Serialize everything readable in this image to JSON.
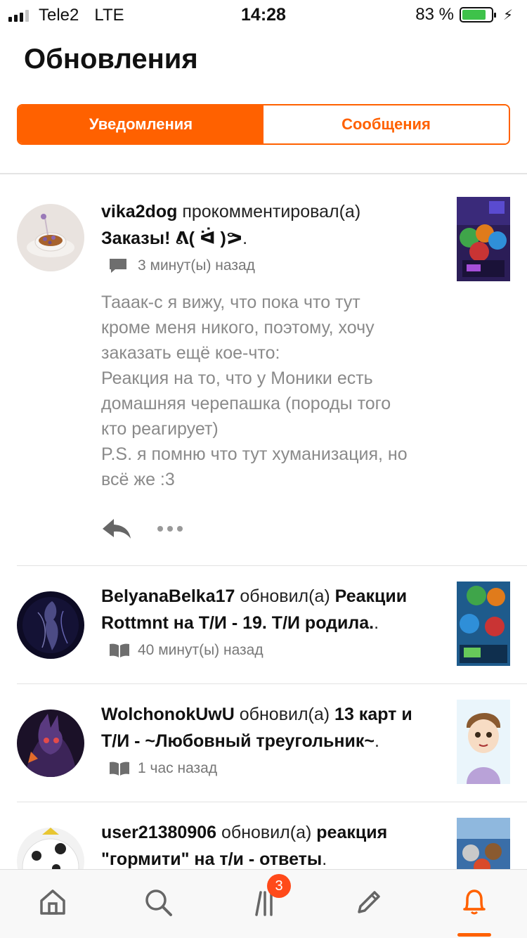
{
  "status_bar": {
    "carrier": "Tele2",
    "network": "LTE",
    "time": "14:28",
    "battery": "83 %",
    "battery_level": 0.83
  },
  "header": {
    "title": "Обновления",
    "tabs": [
      {
        "label": "Уведомления",
        "active": true
      },
      {
        "label": "Сообщения",
        "active": false
      }
    ]
  },
  "feed": [
    {
      "user": "vika2dog",
      "action": "прокомментировал(а)",
      "target": "Заказы! ᕕ( ᐛ )ᕗ",
      "target_suffix": ".",
      "meta_icon": "comment-icon",
      "time": "3 минут(ы) назад",
      "comment_lines": [
        "Тааак-с я вижу, что пока что тут",
        "кроме меня никого, поэтому, хочу",
        "заказать ещё кое-что:",
        "Реакция на то, что у Моники есть",
        "домашняя черепашка (породы того",
        "кто реагирует)",
        "P.S. я помню что тут хуманизация, но",
        "всё же :3"
      ]
    },
    {
      "user": "BelyanaBelka17",
      "action": "обновил(а)",
      "target_line1": "Реакции",
      "target_line2": "Rottmnt на Т/И - 19. Т/И родила.",
      "target_suffix": ".",
      "meta_icon": "book-icon",
      "time": "40 минут(ы) назад"
    },
    {
      "user": "WolchonokUwU",
      "action": "обновил(а)",
      "target_line1": "13 карт и",
      "target_line2": "Т/И - ~Любовный треугольник~",
      "target_suffix": ".",
      "meta_icon": "book-icon",
      "time": "1 час назад"
    },
    {
      "user": "user21380906",
      "action": "обновил(а)",
      "target_line1": "реакция",
      "target_line2": "\"гормити\" на т/и - ответы",
      "target_suffix": "."
    }
  ],
  "tabbar": {
    "items": [
      {
        "name": "home",
        "icon": "home-icon"
      },
      {
        "name": "search",
        "icon": "search-icon"
      },
      {
        "name": "library",
        "icon": "library-icon",
        "badge": "3"
      },
      {
        "name": "write",
        "icon": "pencil-icon"
      },
      {
        "name": "notifications",
        "icon": "bell-icon",
        "active": true
      }
    ]
  },
  "colors": {
    "accent": "#ff6100",
    "badge": "#ff4a1a",
    "muted_text": "#8a8a8a"
  }
}
